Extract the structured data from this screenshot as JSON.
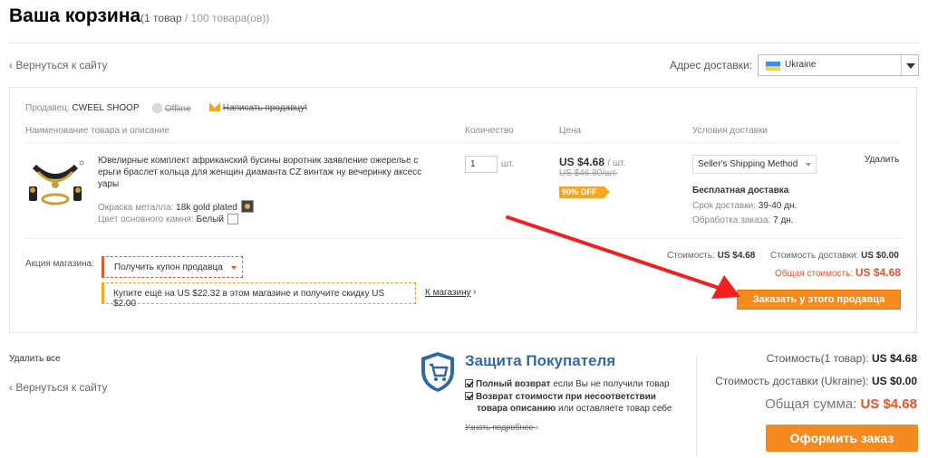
{
  "header": {
    "title": "Ваша корзина",
    "count_open": "(1 товар",
    "count_sep": " / ",
    "count_total": "100 товара(ов))",
    "back_link": "‹ Вернуться к сайту",
    "ship_label": "Адрес доставки:",
    "country": "Ukraine"
  },
  "seller": {
    "label": "Продавец:",
    "name": "CWEEL SHOOP",
    "offline": "Offline",
    "contact": "Написать продавцу!"
  },
  "columns": {
    "product": "Наименование товара и описание",
    "quantity": "Количество",
    "price": "Цена",
    "delivery": "Условия доставки"
  },
  "item": {
    "title": "Ювелирные комплект африканский бусины воротник заявление ожерелье с ерьги браслет кольца для женщин диаманта CZ винтаж ну вечеринку аксесс уары",
    "attr1_label": "Окраска металла:",
    "attr1_value": "18k gold plated",
    "attr2_label": "Цвет основного камня:",
    "attr2_value": "Белый",
    "qty": "1",
    "qty_unit": "шт.",
    "price": "US $4.68",
    "price_unit": "/ шт.",
    "old_price": "US $46.80/шт.",
    "discount": "90% OFF",
    "ship_method": "Seller's Shipping Method",
    "free_shipping": "Бесплатная доставка",
    "delivery_time_label": "Срок доставки:",
    "delivery_time": "39-40 дн.",
    "processing_label": "Обработка заказа:",
    "processing": "7 дн.",
    "remove": "Удалить"
  },
  "promo": {
    "label": "Акция магазина:",
    "coupon": "Получить купон продавца",
    "buy_more": "Купите ещё на US $22.32 в этом магазине и получите скидку US $2.00",
    "store_link": "К магазину",
    "store_arrow": "›"
  },
  "seller_summary": {
    "cost_label": "Стоимость:",
    "cost": "US $4.68",
    "ship_label": "Стоимость доставки:",
    "ship": "US $0.00",
    "total_label": "Общая стоимость:",
    "total": "US $4.68",
    "order_button": "Заказать у этого продавца"
  },
  "bottom": {
    "delete_all": "Удалить все",
    "back_link": "‹ Вернуться к сайту",
    "protect_title": "Защита Покупателя",
    "p1_bold": "Полный возврат",
    "p1_rest": " если Вы не получили товар",
    "p2_bold_a": "Возврат стоимости при несоответствии",
    "p2_bold_b": "товара описанию",
    "p2_rest": " или оставляете товар себе",
    "details": "Узнать подробнее",
    "details_arrow": "›"
  },
  "summary": {
    "cost_label": "Стоимость(1 товар):",
    "cost": "US $4.68",
    "ship_label": "Стоимость доставки (Ukraine):",
    "ship": "US $0.00",
    "grand_label": "Общая сумма:",
    "grand": "US $4.68",
    "checkout": "Оформить заказ"
  },
  "colors": {
    "accent": "#f58a1f",
    "price_red": "#e8532c",
    "protect_blue": "#2f6aa3"
  }
}
